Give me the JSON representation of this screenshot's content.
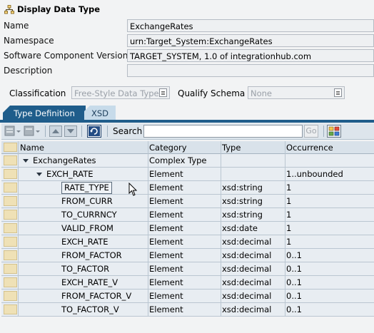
{
  "header": {
    "title": "Display Data Type",
    "icon": "data-type-icon"
  },
  "form": {
    "name_label": "Name",
    "name_value": "ExchangeRates",
    "namespace_label": "Namespace",
    "namespace_value": "urn:Target_System:ExchangeRates",
    "swcv_label": "Software Component Version",
    "swcv_value": "TARGET_SYSTEM, 1.0 of integrationhub.com",
    "description_label": "Description",
    "description_value": ""
  },
  "classification": {
    "label": "Classification",
    "value": "Free-Style Data Type",
    "qualify_label": "Qualify Schema",
    "qualify_value": "None"
  },
  "tabs": [
    {
      "label": "Type Definition",
      "active": true
    },
    {
      "label": "XSD",
      "active": false
    }
  ],
  "toolbar": {
    "search_label": "Search",
    "search_value": "",
    "go_label": "Go"
  },
  "grid": {
    "columns": [
      "Name",
      "Category",
      "Type",
      "Occurrence"
    ],
    "rows": [
      {
        "name": "ExchangeRates",
        "level": 0,
        "expanded": true,
        "category": "Complex Type",
        "type": "",
        "occurrence": ""
      },
      {
        "name": "EXCH_RATE",
        "level": 1,
        "expanded": true,
        "category": "Element",
        "type": "",
        "occurrence": "1..unbounded"
      },
      {
        "name": "RATE_TYPE",
        "level": 2,
        "focused": true,
        "category": "Element",
        "type": "xsd:string",
        "occurrence": "1"
      },
      {
        "name": "FROM_CURR",
        "level": 2,
        "category": "Element",
        "type": "xsd:string",
        "occurrence": "1"
      },
      {
        "name": "TO_CURRNCY",
        "level": 2,
        "category": "Element",
        "type": "xsd:string",
        "occurrence": "1"
      },
      {
        "name": "VALID_FROM",
        "level": 2,
        "category": "Element",
        "type": "xsd:date",
        "occurrence": "1"
      },
      {
        "name": "EXCH_RATE",
        "level": 2,
        "category": "Element",
        "type": "xsd:decimal",
        "occurrence": "1"
      },
      {
        "name": "FROM_FACTOR",
        "level": 2,
        "category": "Element",
        "type": "xsd:decimal",
        "occurrence": "0..1"
      },
      {
        "name": "TO_FACTOR",
        "level": 2,
        "category": "Element",
        "type": "xsd:decimal",
        "occurrence": "0..1"
      },
      {
        "name": "EXCH_RATE_V",
        "level": 2,
        "category": "Element",
        "type": "xsd:decimal",
        "occurrence": "0..1"
      },
      {
        "name": "FROM_FACTOR_V",
        "level": 2,
        "category": "Element",
        "type": "xsd:decimal",
        "occurrence": "0..1"
      },
      {
        "name": "TO_FACTOR_V",
        "level": 2,
        "category": "Element",
        "type": "xsd:decimal",
        "occurrence": "0..1"
      }
    ]
  },
  "colors": {
    "tab_active": "#1f5d8b",
    "tab_inactive": "#c7dbea",
    "row_selector": "#efe1b6"
  }
}
